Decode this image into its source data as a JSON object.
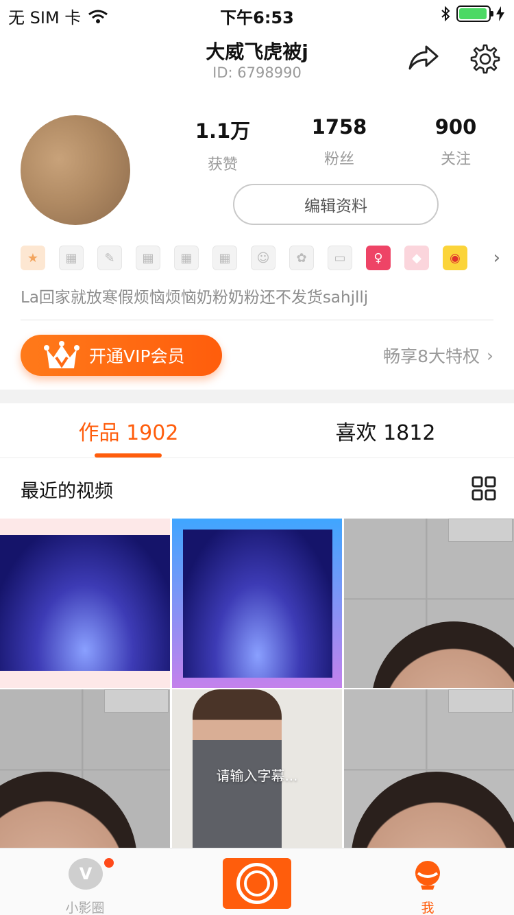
{
  "status_bar": {
    "carrier": "无 SIM 卡",
    "time": "下午6:53",
    "battery_level": 0.95
  },
  "header": {
    "username": "大威飞虎被j",
    "user_id": "ID: 6798990",
    "share_icon": "share-icon",
    "settings_icon": "gear-icon"
  },
  "profile": {
    "stats": [
      {
        "value": "1.1万",
        "label": "获赞"
      },
      {
        "value": "1758",
        "label": "粉丝"
      },
      {
        "value": "900",
        "label": "关注"
      }
    ],
    "edit_label": "编辑资料",
    "bio": "La回家就放寒假烦恼烦恼奶粉奶粉还不发货sahjllj"
  },
  "vip": {
    "button_label": "开通VIP会员",
    "perks_label": "畅享8大特权"
  },
  "tabs": [
    {
      "label": "作品 1902",
      "active": true
    },
    {
      "label": "喜欢 1812",
      "active": false
    }
  ],
  "section": {
    "title": "最近的视频"
  },
  "videos": [
    {
      "caption": ""
    },
    {
      "caption": ""
    },
    {
      "caption": ""
    },
    {
      "caption": ""
    },
    {
      "caption": "请输入字幕..."
    },
    {
      "caption": ""
    }
  ],
  "bottom_nav": {
    "circle_label": "小影圈",
    "me_label": "我"
  },
  "colors": {
    "accent": "#ff5d0c",
    "muted_text": "#9a9a9a"
  }
}
